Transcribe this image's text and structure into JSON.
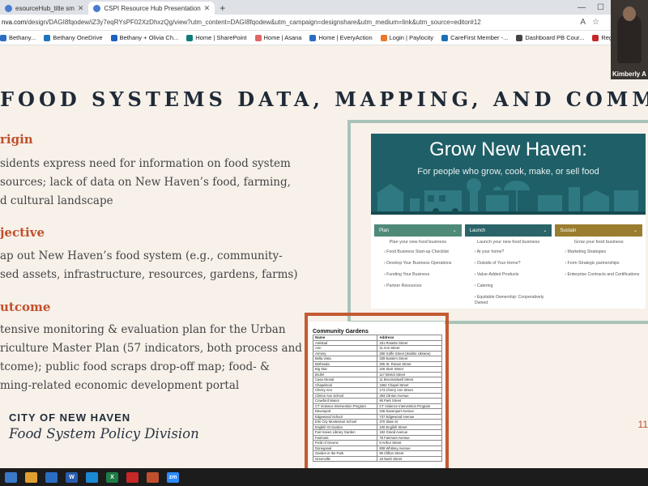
{
  "browser": {
    "tabs": [
      {
        "label": "esourceHub_title sm"
      },
      {
        "label": "CSPI Resource Hub Presentation"
      }
    ],
    "address": {
      "host": "nva.com",
      "path": "/design/DAGI8fqodew/iZ3y7eqRYsPF02XzDhxzQg/view?utm_content=DAGI8fqodew&utm_campaign=designshare&utm_medium=link&utm_source=editor#12"
    },
    "bookmarks": [
      {
        "label": "Bethany...",
        "color": "#2b6cc4"
      },
      {
        "label": "Bethany OneDrive",
        "color": "#1e73be"
      },
      {
        "label": "Bethany + Olivia Ch...",
        "color": "#1f5fbf"
      },
      {
        "label": "Home | SharePoint",
        "color": "#0f7b7b"
      },
      {
        "label": "Home | Asana",
        "color": "#e06666"
      },
      {
        "label": "Home | EveryAction",
        "color": "#2b6cc4"
      },
      {
        "label": "Login | Paylocity",
        "color": "#e8792b"
      },
      {
        "label": "CareFirst Member -...",
        "color": "#1b6fb8"
      },
      {
        "label": "Dashboard PB Cour...",
        "color": "#444444"
      },
      {
        "label": "RegulationSheet | B...",
        "color": "#c62828"
      }
    ]
  },
  "slide": {
    "title": "FOOD SYSTEMS DATA, MAPPING, AND COMMS",
    "sections": [
      {
        "heading": "rigin",
        "lines": [
          "sidents express need for information on food system",
          "sources; lack of data on New Haven’s food, farming,",
          "d cultural landscape"
        ]
      },
      {
        "heading": "jective",
        "lines": [
          "ap out New Haven’s food system (e.g., community-",
          "sed assets, infrastructure, resources, gardens, farms)"
        ]
      },
      {
        "heading": "utcome",
        "lines": [
          "tensive monitoring & evaluation plan for the Urban",
          "riculture Master Plan (57 indicators, both process and",
          "tcome); public food scraps drop-off map; food- &",
          "ming-related economic development portal"
        ]
      }
    ],
    "footer": {
      "city": "CITY OF NEW HAVEN",
      "division": "Food System Policy Division"
    },
    "page_number": "11",
    "grow": {
      "title": "Grow New Haven:",
      "subtitle": "For people who grow, cook, make, or sell food",
      "columns": [
        {
          "label": "Plan",
          "color": "#4f8a78",
          "subtitle": "Plan your new food business",
          "items": [
            "Food Business Start-up Checklist",
            "Develop Your Business Operations",
            "Funding Your Business",
            "Partner Resources"
          ]
        },
        {
          "label": "Launch",
          "color": "#2a6468",
          "subtitle": "Launch your new food business",
          "items": [
            "At your home?",
            "Outside of Your Home?",
            "Value-Added Products",
            "Catering",
            "Equitable Ownership: Cooperatively Owned"
          ]
        },
        {
          "label": "Sustain",
          "color": "#9a7d2e",
          "subtitle": "Grow your food business",
          "items": [
            "Marketing Strategies",
            "Form Strategic partnerships",
            "Enterprise Contracts and Certifications"
          ]
        }
      ]
    },
    "gardens": {
      "title": "Community Gardens",
      "headers": [
        "Name",
        "Address"
      ],
      "rows": [
        [
          "Amistad",
          "151 Rosette Street"
        ],
        [
          "Ann",
          "11 Ann Street"
        ],
        [
          "Armory",
          "290 Goffe Street (Starlite Ukraine)"
        ],
        [
          "Bella Vista",
          "339 Eastern Street"
        ],
        [
          "Bethesda",
          "205 St. Ronan Street"
        ],
        [
          "Big Star",
          "226 Starr Street"
        ],
        [
          "Brufel",
          "117 Bristol Street"
        ],
        [
          "Casa Otonal",
          "11 Broomsdwell Street"
        ],
        [
          "Chapelsoul",
          "1562 Chapel Street"
        ],
        [
          "Cherry Ann",
          "173 Cherry Ann Street"
        ],
        [
          "Clinton Ave School",
          "293 Clinton Avenue"
        ],
        [
          "Crawford Manor",
          "90 Park Street"
        ],
        [
          "CT Violence Intervention Program",
          "CT Violence Intervention Program"
        ],
        [
          "Davenport",
          "345 Davenport Avenue"
        ],
        [
          "Edgewood School",
          "737 Edgewood Avenue"
        ],
        [
          "Elm City Montessori School",
          "370 Slate St"
        ],
        [
          "English St Garden",
          "100 English Street"
        ],
        [
          "Fair Haven Library Garden",
          "182 Grand Avenue"
        ],
        [
          "Fairmont",
          "78 Fairmont Avenue"
        ],
        [
          "Field of Greens",
          "8 Arthur Street"
        ],
        [
          "Doneganal",
          "808 Whitney Avenue"
        ],
        [
          "Garden in the Park",
          "90 Clifton Street"
        ],
        [
          "Greenville",
          "18 Nash Street"
        ]
      ]
    }
  },
  "webcam": {
    "name": "Kimberly A"
  },
  "taskbar": [
    {
      "label": "",
      "color": "#3a78c9"
    },
    {
      "label": "",
      "color": "#e0a030"
    },
    {
      "label": "",
      "color": "#2b6cc4"
    },
    {
      "label": "W",
      "color": "#2b5cae"
    },
    {
      "label": "",
      "color": "#1b8ad4"
    },
    {
      "label": "X",
      "color": "#1e7b46"
    },
    {
      "label": "",
      "color": "#c62828"
    },
    {
      "label": "",
      "color": "#c0502c"
    },
    {
      "label": "zm",
      "color": "#2d8cff"
    }
  ]
}
